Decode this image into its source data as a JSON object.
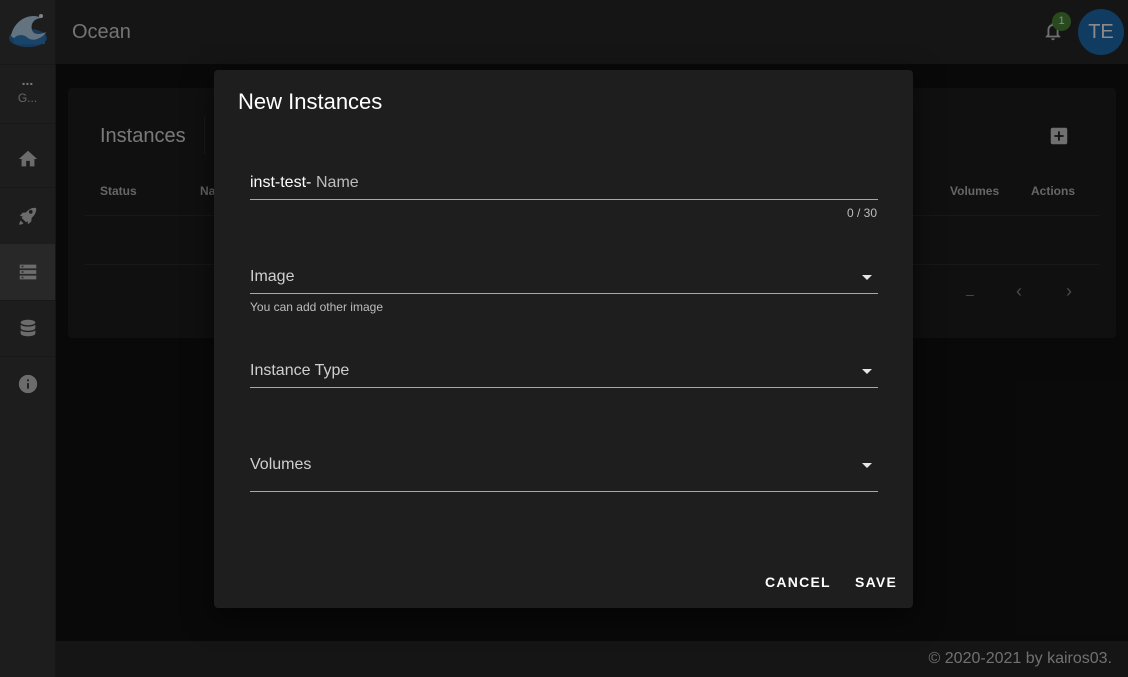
{
  "app": {
    "title": "Ocean"
  },
  "sidebar": {
    "workspace": {
      "dots": "...",
      "label": "G..."
    },
    "items": [
      {
        "name": "home",
        "icon": "home-icon"
      },
      {
        "name": "rocket",
        "icon": "rocket-icon"
      },
      {
        "name": "instances",
        "icon": "server-icon",
        "active": true
      },
      {
        "name": "volumes",
        "icon": "database-icon"
      },
      {
        "name": "info",
        "icon": "info-icon"
      }
    ]
  },
  "header": {
    "notifications_count": "1",
    "avatar_initials": "TE"
  },
  "page": {
    "card_title": "Instances",
    "columns": {
      "status": "Status",
      "name": "Na",
      "volumes": "Volumes",
      "actions": "Actions"
    },
    "pagination": {
      "range": "–"
    }
  },
  "dialog": {
    "title": "New Instances",
    "name_prefix": "inst-test-",
    "name_label": "Name",
    "name_counter": "0 / 30",
    "image_label": "Image",
    "image_hint": "You can add other image",
    "instance_type_label": "Instance Type",
    "volumes_label": "Volumes",
    "cancel_label": "CANCEL",
    "save_label": "SAVE"
  },
  "footer": {
    "text": "© 2020-2021 by kairos03."
  },
  "colors": {
    "avatar": "#1f6fb3",
    "badge": "#4c8a3a",
    "dialog_bg": "#1e1e1e"
  }
}
